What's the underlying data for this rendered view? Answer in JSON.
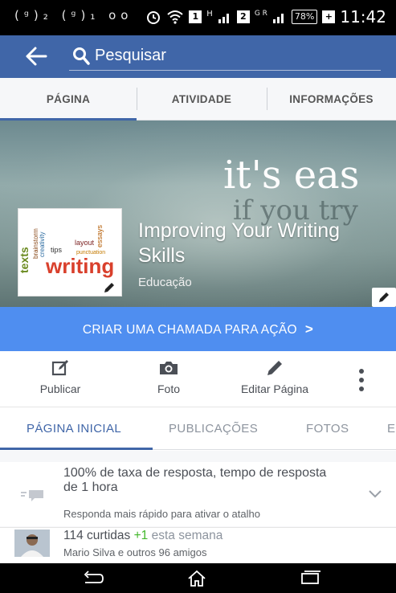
{
  "status_bar": {
    "left_icons": "(ᵍ)₂ (ᵍ)₁ oo",
    "network_2g_label": "H",
    "network_3g_label": "G R",
    "sim1_badge": "1",
    "sim2_badge": "2",
    "battery": "78%",
    "time": "11:42"
  },
  "search": {
    "placeholder": "Pesquisar"
  },
  "top_tabs": [
    {
      "label": "PÁGINA",
      "active": true
    },
    {
      "label": "ATIVIDADE",
      "active": false
    },
    {
      "label": "INFORMAÇÕES",
      "active": false
    }
  ],
  "cover": {
    "quote_line1": "it's eas",
    "quote_line2": "if you try",
    "page_name": "Improving Your Writing Skills",
    "category": "Educação",
    "profile_words": [
      "texts",
      "brainstorm",
      "creativity",
      "tips",
      "layout",
      "essays",
      "punctuation",
      "writing"
    ]
  },
  "cta": {
    "label": "CRIAR UMA CHAMADA PARA AÇÃO",
    "chevron": ">"
  },
  "actions": [
    {
      "label": "Publicar",
      "icon": "compose-icon"
    },
    {
      "label": "Foto",
      "icon": "camera-icon"
    },
    {
      "label": "Editar Página",
      "icon": "pencil-icon"
    }
  ],
  "page_tabs": [
    {
      "label": "PÁGINA INICIAL",
      "active": true
    },
    {
      "label": "PUBLICAÇÕES",
      "active": false
    },
    {
      "label": "FOTOS",
      "active": false
    },
    {
      "label": "E",
      "active": false
    }
  ],
  "response_card": {
    "title": "100% de taxa de resposta, tempo de resposta de 1 hora",
    "subtitle": "Responda mais rápido para ativar o atalho"
  },
  "likes_card": {
    "count_text": "114 curtidas",
    "delta": "+1",
    "period": "esta semana",
    "friends_text": "Mario Silva e outros 96 amigos"
  },
  "colors": {
    "fb_blue": "#4066a8",
    "cta_blue": "#4f8ef0",
    "green": "#42b72a"
  }
}
